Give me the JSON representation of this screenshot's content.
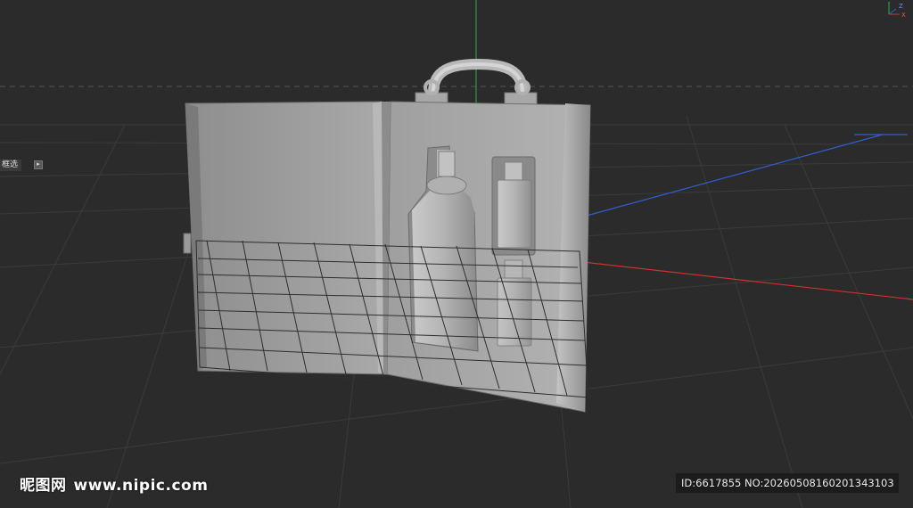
{
  "viewport": {
    "background": "#2b2b2b",
    "axis_colors": {
      "x": "#d0312d",
      "y": "#2fae4f",
      "z": "#2f5fd0"
    },
    "gizmo_labels": {
      "x": "X",
      "z": "Z"
    }
  },
  "hud": {
    "filter_label": "框选",
    "filter_button_icon": "play-arrow-icon",
    "filter_button_glyph": "▸"
  },
  "model": {
    "name": "bottle-case",
    "items": [
      "case-lid",
      "case-body",
      "handle",
      "large-bottle-recess",
      "small-bottle-recess"
    ]
  },
  "watermark": {
    "site_cn": "昵图网",
    "site_url": "www.nipic.com"
  },
  "id_bar": {
    "text": "ID:6617855 NO:20260508160201343103"
  }
}
